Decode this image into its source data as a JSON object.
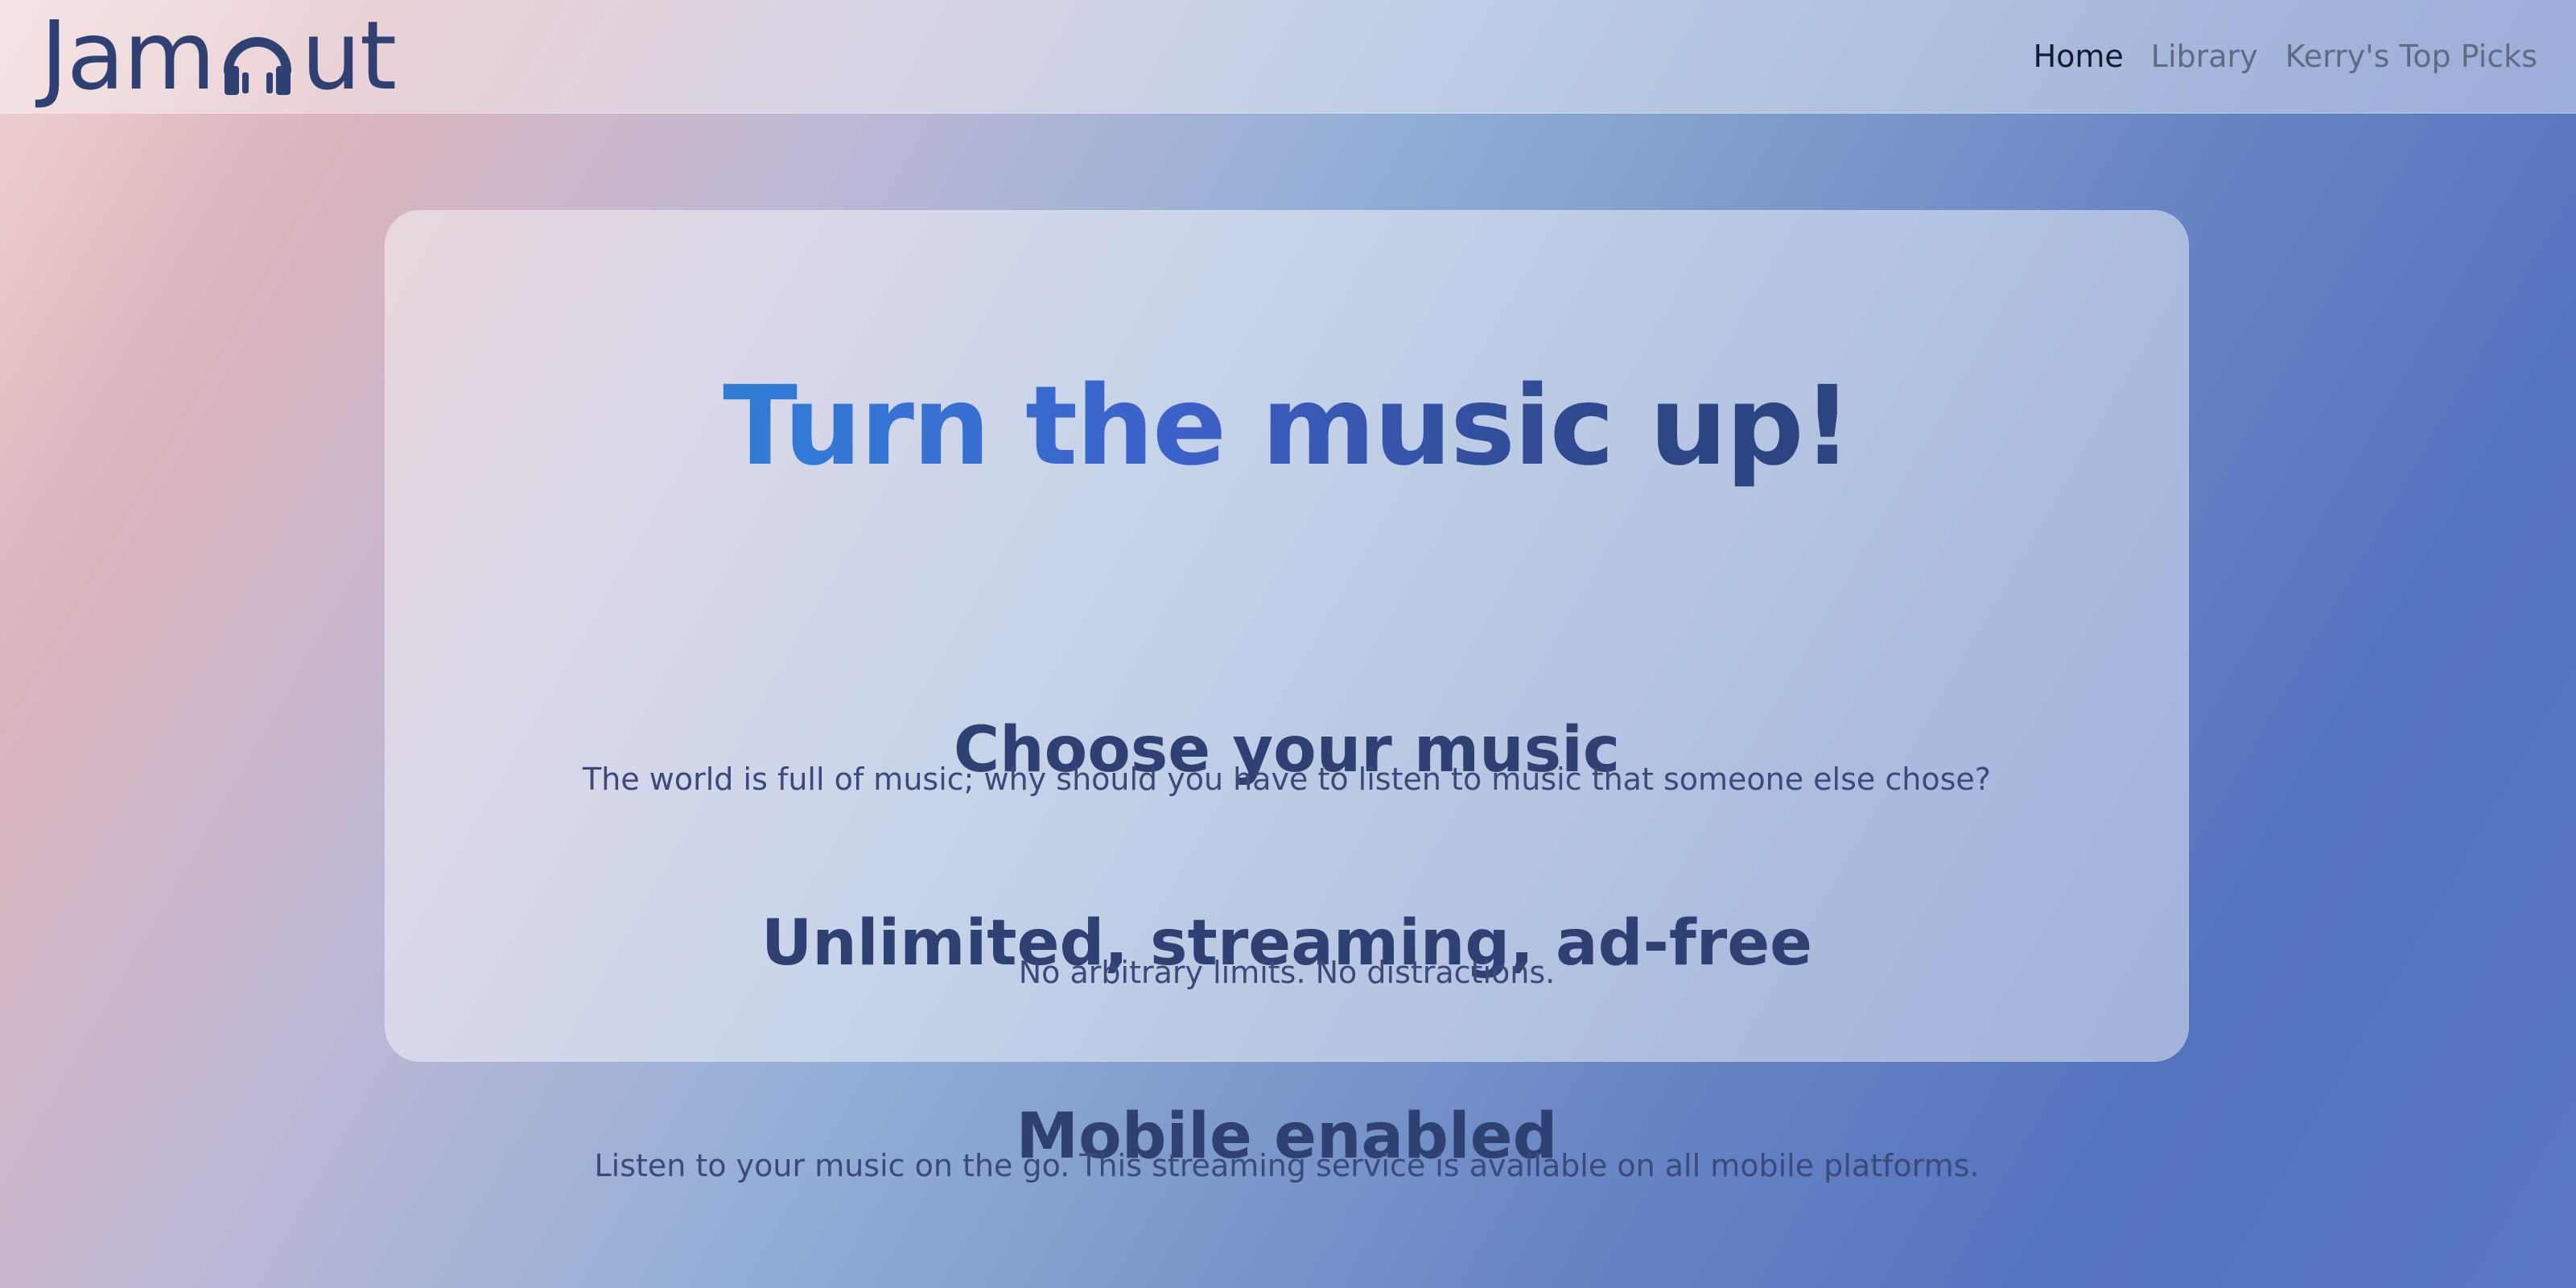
{
  "navbar": {
    "logo_left": "Jam",
    "logo_right": "ut",
    "links": [
      {
        "label": "Home",
        "active": true
      },
      {
        "label": "Library",
        "active": false
      },
      {
        "label": "Kerry's Top Picks",
        "active": false
      }
    ]
  },
  "main": {
    "hero": "Turn the music up!",
    "sections": [
      {
        "title": "Choose your music",
        "text": "The world is full of music; why should you have to listen to music that someone else chose?"
      },
      {
        "title": "Unlimited, streaming, ad-free",
        "text": "No arbitrary limits. No distractions."
      },
      {
        "title": "Mobile enabled",
        "text": "Listen to your music on the go. This streaming service is available on all mobile platforms."
      }
    ]
  },
  "icons": {
    "logo_o": "headphones-icon"
  },
  "colors": {
    "brand": "#2f4173",
    "hero_gradient_start": "#2d8fd3",
    "hero_gradient_end": "#2d3f78",
    "nav_active": "#111a2e",
    "nav_inactive": "#5f6b83"
  }
}
